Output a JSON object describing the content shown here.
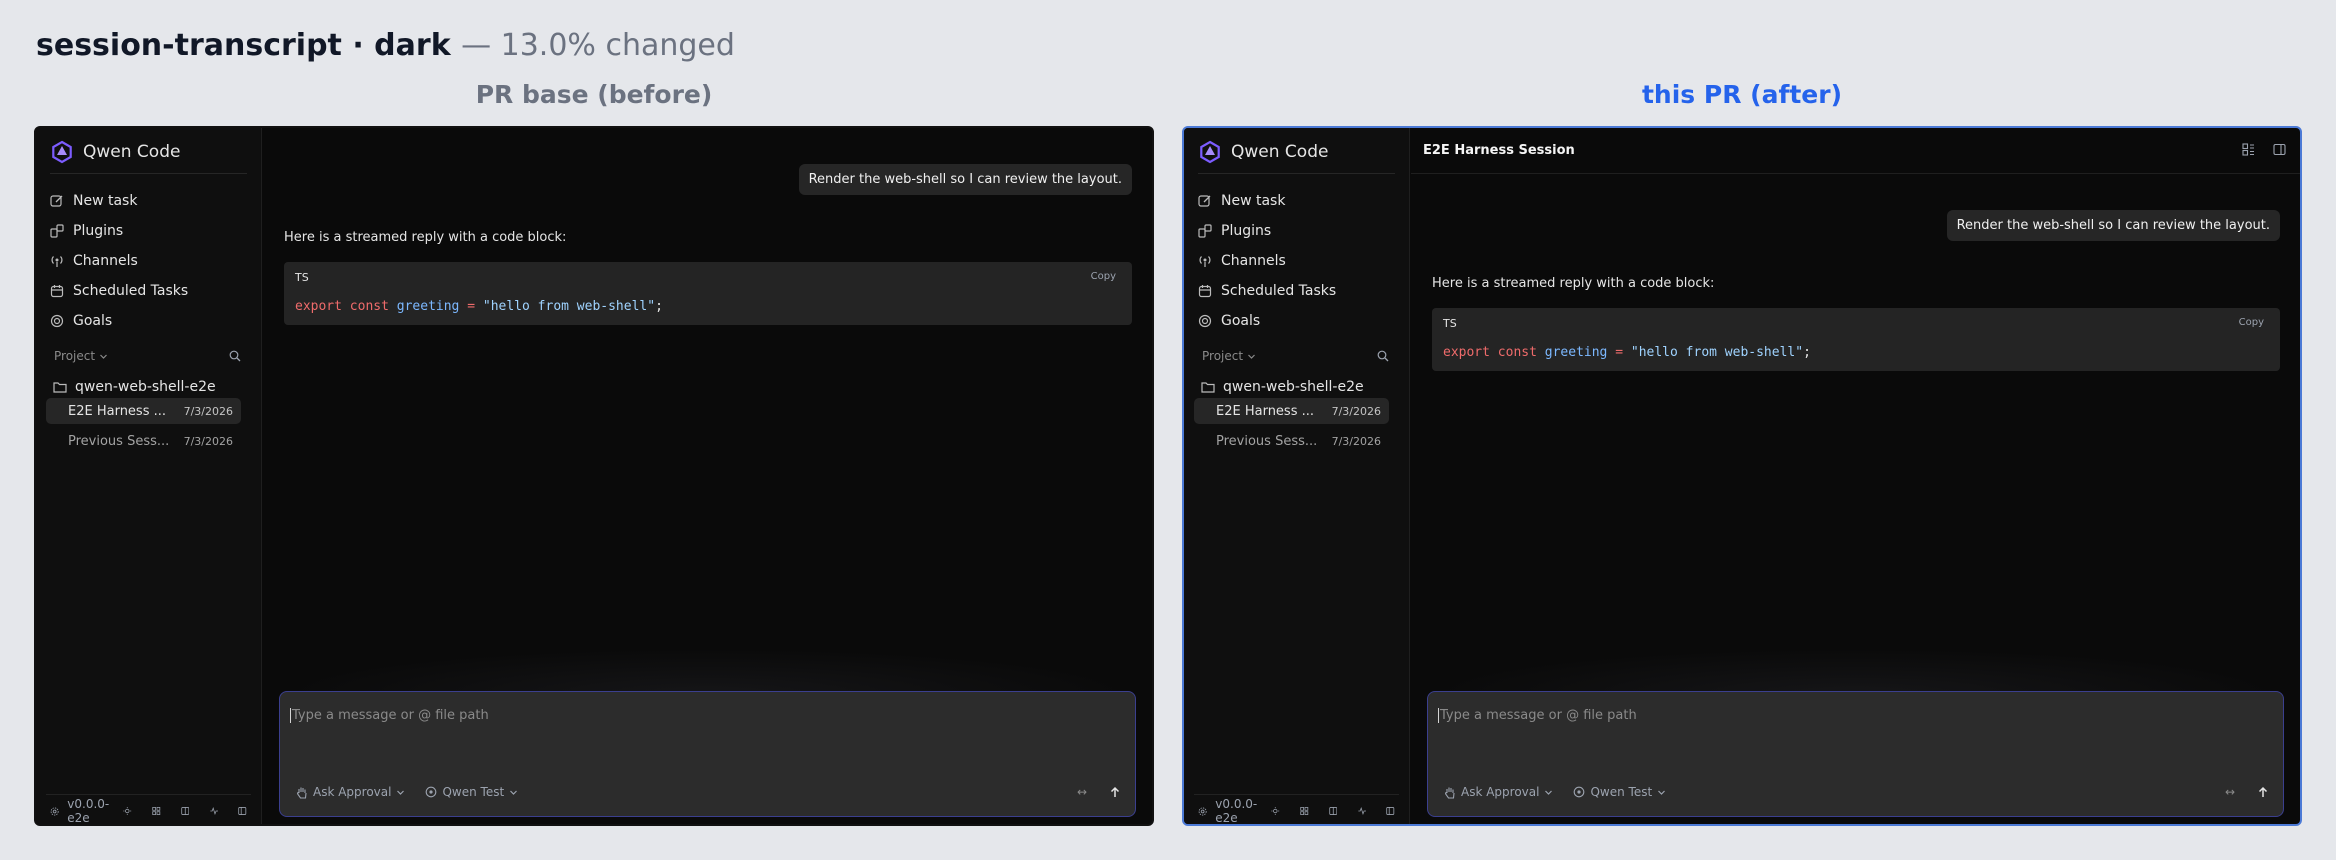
{
  "page": {
    "title": "session-transcript · dark",
    "change_note": "— 13.0% changed",
    "colors": {
      "background": "#e5e7eb",
      "before_heading": "#6b7280",
      "after_heading": "#2563eb",
      "after_border": "#4c7ad6",
      "accent": "#8b5cf6"
    }
  },
  "before": {
    "heading": "PR base (before)",
    "app_name": "Qwen Code",
    "nav": [
      "New task",
      "Plugins",
      "Channels",
      "Scheduled Tasks",
      "Goals"
    ],
    "project_label": "Project",
    "folder": "qwen-web-shell-e2e",
    "sessions": [
      {
        "title": "E2E Harness ...",
        "date": "7/3/2026"
      },
      {
        "title": "Previous Sess...",
        "date": "7/3/2026"
      }
    ],
    "version": "v0.0.0-e2e",
    "user_message": "Render the web-shell so I can review the layout.",
    "assistant_text": "Here is a streamed reply with a code block:",
    "code": {
      "lang": "TS",
      "copy": "Copy",
      "tokens": {
        "kw1": "export",
        "kw2": "const",
        "ident": "greeting",
        "op": "=",
        "str": "\"hello from web-shell\"",
        "end": ";"
      }
    },
    "composer": {
      "placeholder": "Type a message or @ file path",
      "approval": "Ask Approval",
      "model": "Qwen Test",
      "expand": "↔"
    }
  },
  "after": {
    "heading": "this PR (after)",
    "app_name": "Qwen Code",
    "session_title": "E2E Harness Session",
    "nav": [
      "New task",
      "Plugins",
      "Channels",
      "Scheduled Tasks",
      "Goals"
    ],
    "project_label": "Project",
    "folder": "qwen-web-shell-e2e",
    "sessions": [
      {
        "title": "E2E Harness ...",
        "date": "7/3/2026"
      },
      {
        "title": "Previous Sess...",
        "date": "7/3/2026"
      }
    ],
    "version": "v0.0.0-e2e",
    "user_message": "Render the web-shell so I can review the layout.",
    "assistant_text": "Here is a streamed reply with a code block:",
    "code": {
      "lang": "TS",
      "copy": "Copy",
      "tokens": {
        "kw1": "export",
        "kw2": "const",
        "ident": "greeting",
        "op": "=",
        "str": "\"hello from web-shell\"",
        "end": ";"
      }
    },
    "composer": {
      "placeholder": "Type a message or @ file path",
      "approval": "Ask Approval",
      "model": "Qwen Test",
      "expand": "↔"
    }
  }
}
